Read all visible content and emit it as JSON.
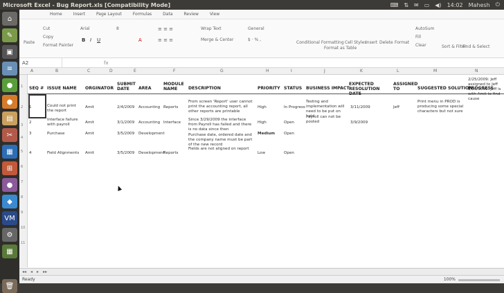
{
  "window": {
    "title": "Microsoft Excel - Bug Report.xls  [Compatibility Mode]"
  },
  "tray": {
    "time": "14:02",
    "user": "Mahesh"
  },
  "ribbon_tabs": [
    "Home",
    "Insert",
    "Page Layout",
    "Formulas",
    "Data",
    "Review",
    "View"
  ],
  "ribbon": {
    "paste": "Paste",
    "cut": "Cut",
    "copy": "Copy",
    "format_painter": "Format Painter",
    "font": "Arial",
    "font_size": "8",
    "wrap_text": "Wrap Text",
    "merge_center": "Merge & Center",
    "number_format": "General",
    "conditional_formatting": "Conditional Formatting",
    "format_as_table": "Format as Table",
    "cell_styles": "Cell Styles",
    "insert": "Insert",
    "delete": "Delete",
    "format": "Format",
    "autosum": "AutoSum",
    "fill": "Fill",
    "clear": "Clear",
    "sort_filter": "Sort & Filter",
    "find_select": "Find & Select"
  },
  "formula_bar": {
    "name_box": "A2",
    "fx": "fx"
  },
  "columns": [
    "A",
    "B",
    "C",
    "D",
    "E",
    "F",
    "G",
    "H",
    "I",
    "J",
    "K",
    "L",
    "M",
    "N"
  ],
  "headers": {
    "seq": "SEQ #",
    "issue_name": "ISSUE NAME",
    "originator": "ORGINATOR",
    "submit_date": "SUBMIT DATE",
    "area": "AREA",
    "module_name": "MODULE NAME",
    "description": "DESCRIPTION",
    "priority": "PRIORITY",
    "status": "STATUS",
    "business_impact": "BUSINESS IMPACT",
    "expected_resolution": "EXPECTED RESOLUTION DATE",
    "assigned_to": "ASSIGNED TO",
    "suggested_solution": "SUGGESTED SOLUTION",
    "progress": "PROGRESS"
  },
  "rows": [
    {
      "seq": "1",
      "issue_name": "Could not print the report",
      "originator": "Amit",
      "submit_date": "2/4/2009",
      "area": "Accounting",
      "module_name": "Reports",
      "description": "From screen 'Report' user cannot print the accounting report, all other reports are printable",
      "priority": "High",
      "status": "In Progress",
      "business_impact": "Testing and implementation will need to be put on hold",
      "expected_resolution": "3/11/2009",
      "assigned_to": "Jeff",
      "suggested_solution": "Print menu in PROD is producing some special characters but not sure",
      "progress": "2/25/2009: Jeff assigned to Jeff 2/26/2009: Jeff is with Amit to find cause"
    },
    {
      "seq": "2",
      "issue_name": "Interface failure with payroll",
      "originator": "Amit",
      "submit_date": "3/1/2009",
      "area": "Accounting",
      "module_name": "Interface",
      "description": "Since 3/29/2009 the interface from Payroll has failed and there is no data since then",
      "priority": "High",
      "status": "Open",
      "business_impact": "Payroll can not be posted",
      "expected_resolution": "3/9/2009",
      "assigned_to": "",
      "suggested_solution": "",
      "progress": ""
    },
    {
      "seq": "3",
      "issue_name": "Purchase",
      "originator": "Amit",
      "submit_date": "3/5/2009",
      "area": "Development",
      "module_name": "",
      "description": "Purchase date, ordered date and the company name must be part of the new record",
      "priority": "Medium",
      "status": "Open",
      "business_impact": "",
      "expected_resolution": "",
      "assigned_to": "",
      "suggested_solution": "",
      "progress": ""
    },
    {
      "seq": "4",
      "issue_name": "Field Alignments",
      "originator": "Amit",
      "submit_date": "3/5/2009",
      "area": "Development",
      "module_name": "Reports",
      "description": "Fields are not aligned on report",
      "priority": "Low",
      "status": "Open",
      "business_impact": "",
      "expected_resolution": "",
      "assigned_to": "",
      "suggested_solution": "",
      "progress": ""
    }
  ],
  "status": {
    "ready": "Ready",
    "zoom": "100%"
  }
}
